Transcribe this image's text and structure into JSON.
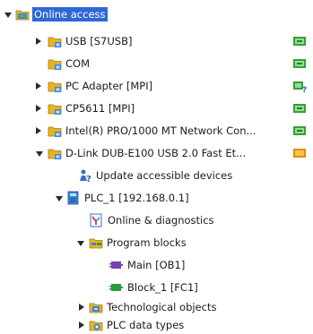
{
  "tree": {
    "root": {
      "label": "Online access",
      "icon": "online-access-folder-icon",
      "state": "expanded"
    },
    "interfaces": [
      {
        "label": "USB [S7USB]",
        "icon": "folder-network-icon",
        "state": "collapsed",
        "status": "green"
      },
      {
        "label": "COM",
        "icon": "folder-network-icon",
        "state": "none",
        "status": "green"
      },
      {
        "label": "PC Adapter [MPI]",
        "icon": "folder-network-icon",
        "state": "collapsed",
        "status": "green-question"
      },
      {
        "label": "CP5611 [MPI]",
        "icon": "folder-network-icon",
        "state": "collapsed",
        "status": "green"
      },
      {
        "label": "Intel(R) PRO/1000 MT Network Con...",
        "icon": "folder-network-icon",
        "state": "collapsed",
        "status": "green"
      },
      {
        "label": "D-Link DUB-E100 USB 2.0 Fast Et...",
        "icon": "folder-network-icon",
        "state": "expanded",
        "status": "orange"
      }
    ],
    "update_devices": {
      "label": "Update accessible devices",
      "icon": "update-devices-icon"
    },
    "plc": {
      "label": "PLC_1 [192.168.0.1]",
      "icon": "plc-icon",
      "state": "expanded"
    },
    "online_diagnostics": {
      "label": "Online & diagnostics",
      "icon": "diagnostics-icon"
    },
    "program_blocks": {
      "label": "Program blocks",
      "icon": "program-blocks-folder-icon",
      "state": "expanded"
    },
    "blocks": [
      {
        "label": "Main [OB1]",
        "icon": "ob-block-icon",
        "color": "#7a3fb0"
      },
      {
        "label": "Block_1 [FC1]",
        "icon": "fc-block-icon",
        "color": "#2a9a3a"
      }
    ],
    "technological_objects": {
      "label": "Technological objects",
      "icon": "technological-objects-folder-icon",
      "state": "collapsed"
    },
    "plc_data_types": {
      "label": "PLC data types",
      "icon": "plc-data-types-folder-icon",
      "state": "collapsed"
    }
  }
}
